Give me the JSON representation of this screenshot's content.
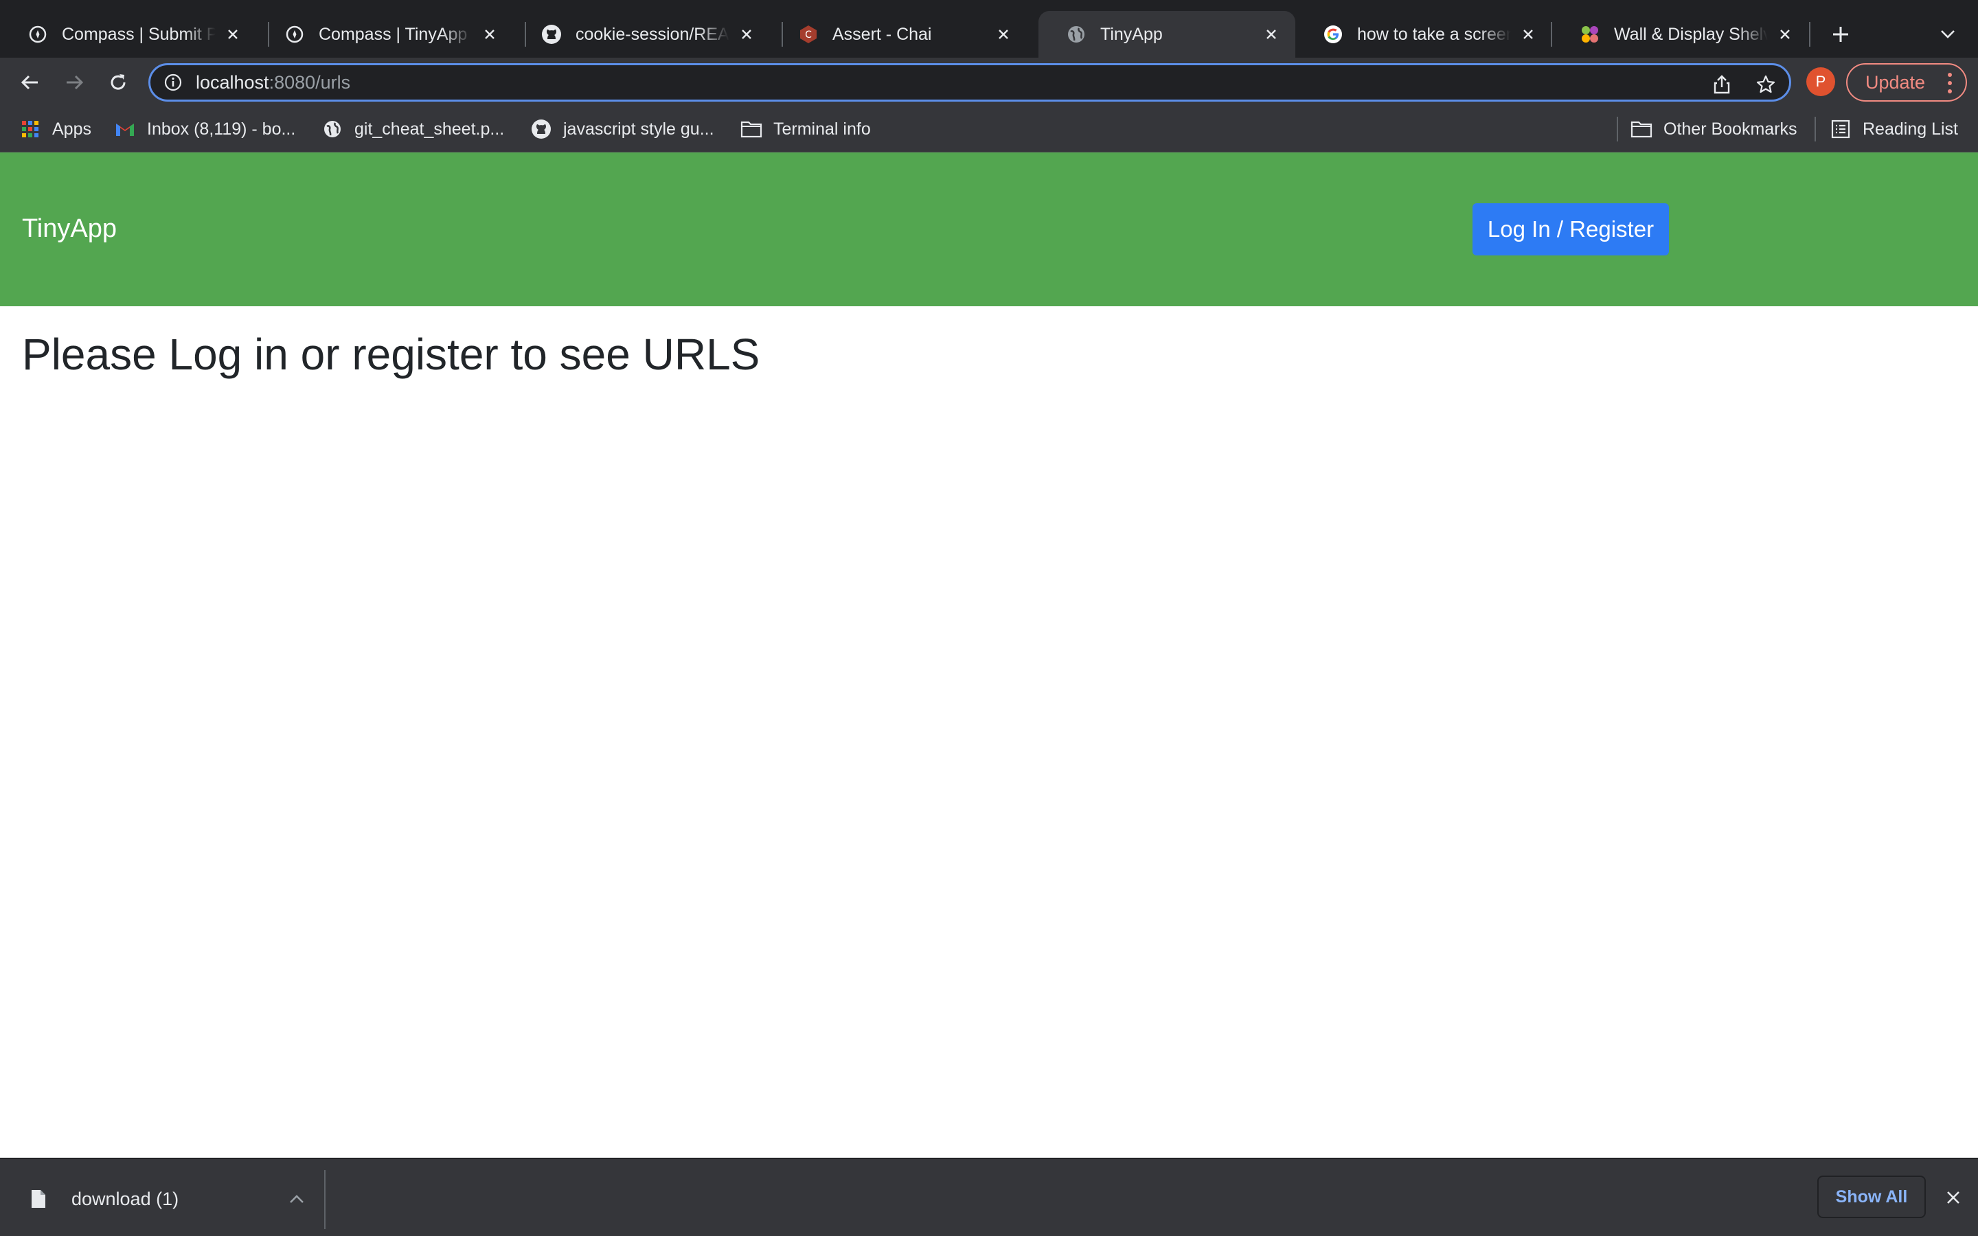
{
  "browser": {
    "tabs": [
      {
        "title": "Compass | Submit Pro",
        "icon": "compass-icon",
        "active": false
      },
      {
        "title": "Compass | TinyApp",
        "icon": "compass-icon",
        "active": false
      },
      {
        "title": "cookie-session/README",
        "icon": "github-icon",
        "active": false
      },
      {
        "title": "Assert - Chai",
        "icon": "chai-icon",
        "active": false
      },
      {
        "title": "TinyApp",
        "icon": "globe-icon",
        "active": true
      },
      {
        "title": "how to take a screenshot",
        "icon": "google-icon",
        "active": false
      },
      {
        "title": "Wall & Display Shelves",
        "icon": "shop-icon",
        "active": false
      }
    ],
    "address_bar": {
      "host": "localhost",
      "rest": ":8080/urls"
    },
    "profile_initial": "P",
    "update_label": "Update",
    "bookmarks": [
      {
        "label": "Apps",
        "icon": "apps-grid-icon"
      },
      {
        "label": "Inbox (8,119) - bo...",
        "icon": "gmail-icon"
      },
      {
        "label": "git_cheat_sheet.p...",
        "icon": "globe-icon"
      },
      {
        "label": "javascript style gu...",
        "icon": "github-icon"
      },
      {
        "label": "Terminal info",
        "icon": "folder-icon"
      }
    ],
    "bookmarks_right": [
      {
        "label": "Other Bookmarks",
        "icon": "folder-icon"
      },
      {
        "label": "Reading List",
        "icon": "reading-list-icon"
      }
    ],
    "download_shelf": {
      "item_label": "download (1)",
      "show_all_label": "Show All"
    }
  },
  "page": {
    "brand": "TinyApp",
    "login_button": "Log In / Register",
    "heading": "Please Log in or register to see URLS"
  },
  "colors": {
    "navbar_green": "#53a650",
    "button_blue": "#2d7bf4",
    "chrome_dark": "#202124",
    "chrome_toolbar": "#35363a",
    "update_accent": "#f28b82",
    "link_blue": "#8ab4f8"
  }
}
